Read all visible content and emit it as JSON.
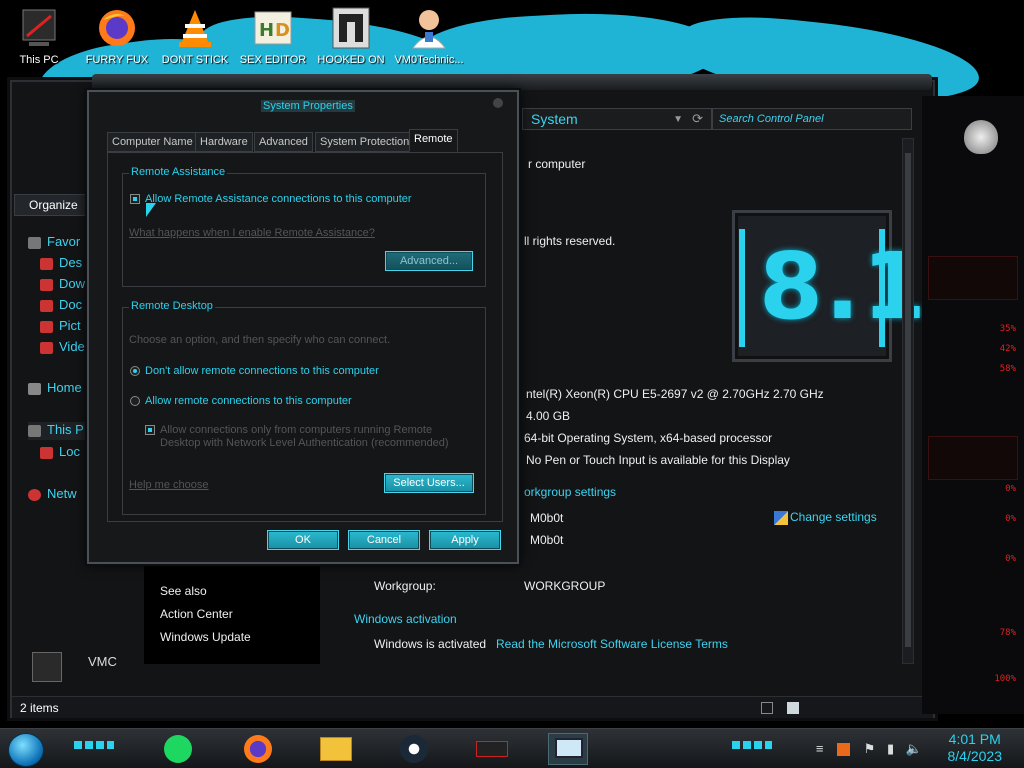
{
  "desktop": {
    "icons": [
      {
        "label": "This PC",
        "icon": "pc-icon"
      },
      {
        "label": "FURRY FUX",
        "icon": "firefox-icon"
      },
      {
        "label": "DONT STICK",
        "icon": "vlc-icon"
      },
      {
        "label": "SEX EDITOR",
        "icon": "hxd-icon"
      },
      {
        "label": "HOOKED ON",
        "icon": "hooked-icon"
      },
      {
        "label": "VM0Technic...",
        "icon": "doctor-icon"
      }
    ]
  },
  "explorer": {
    "address": "System",
    "search_placeholder": "Search Control Panel",
    "organize": "Organize",
    "nav": [
      "Favor",
      "Des",
      "Dow",
      "Doc",
      "Pict",
      "Vide",
      "Home",
      "This P",
      "Loc",
      "Netw"
    ],
    "computer_heading": "r computer",
    "rights": "ll rights reserved.",
    "version_logo": "8.1",
    "processor": "ntel(R) Xeon(R) CPU E5-2697 v2 @ 2.70GHz   2.70 GHz",
    "ram": "4.00 GB",
    "system_type": "64-bit Operating System, x64-based processor",
    "pen_touch": "No Pen or Touch Input is available for this Display",
    "workgroup_settings": "orkgroup settings",
    "computer_name": "M0b0t",
    "full_name": "M0b0t",
    "change_settings": "Change settings",
    "workgroup_label": "Workgroup:",
    "workgroup_value": "WORKGROUP",
    "windows_activation": "Windows activation",
    "activated": "Windows is activated",
    "license_link": "Read the Microsoft Software License Terms",
    "see_also": [
      "See also",
      "Action Center",
      "Windows Update"
    ],
    "status": "2 items",
    "vmc": "VMC"
  },
  "dialog": {
    "title": "System Properties",
    "tabs": [
      "Computer Name",
      "Hardware",
      "Advanced",
      "System Protection",
      "Remote"
    ],
    "remote_assistance": {
      "title": "Remote Assistance",
      "allow_label": "Allow Remote Assistance connections to this computer",
      "allow_checked": true,
      "help_link": "What happens when I enable Remote Assistance?",
      "advanced_button": "Advanced..."
    },
    "remote_desktop": {
      "title": "Remote Desktop",
      "instruction": "Choose an option, and then specify who can connect.",
      "option_deny": "Don't allow remote connections to this computer",
      "option_allow": "Allow remote connections to this computer",
      "nla_line1": "Allow connections only from computers running Remote",
      "nla_line2": "Desktop with Network Level Authentication (recommended)",
      "help_link": "Help me choose",
      "select_users": "Select Users..."
    },
    "buttons": {
      "ok": "OK",
      "cancel": "Cancel",
      "apply": "Apply"
    }
  },
  "right_panel": {
    "percent_labels": [
      "35%",
      "42%",
      "58%",
      "0%",
      "0%",
      "0%",
      "78%",
      "100%"
    ]
  },
  "taskbar": {
    "apps": [
      "spotify-icon",
      "firefox-icon",
      "file-explorer-icon",
      "steam-icon",
      "alienware-icon",
      "remote-desktop-icon"
    ],
    "time": "4:01 PM",
    "date": "8/4/2023"
  },
  "colors": {
    "accent": "#2ad2ee",
    "background": "#161819",
    "alert": "#e02020"
  }
}
